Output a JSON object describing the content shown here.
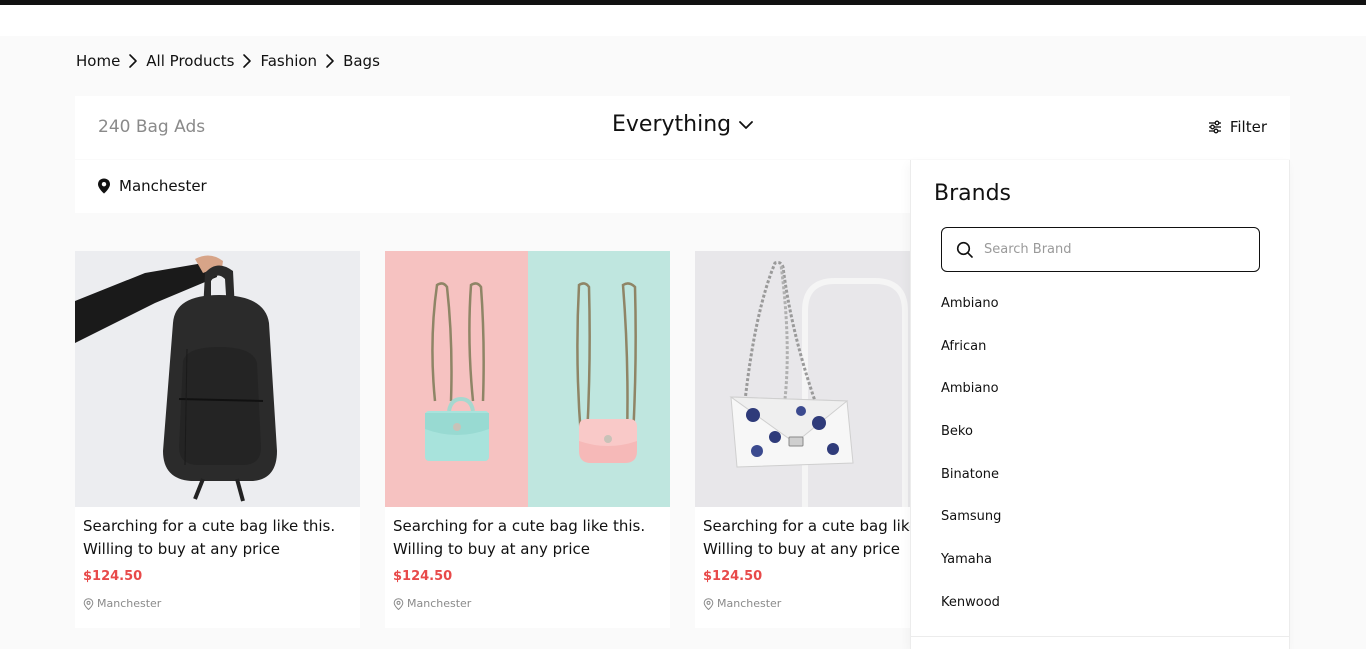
{
  "breadcrumb": [
    "Home",
    "All Products",
    "Fashion",
    "Bags"
  ],
  "toolbar": {
    "ad_count": "240 Bag Ads",
    "sort_label": "Everything",
    "filter_label": "Filter"
  },
  "location": "Manchester",
  "products": [
    {
      "title": "Searching for a cute bag like this. Willing to buy at any price",
      "price": "$124.50",
      "location": "Manchester",
      "image": "black-backpack"
    },
    {
      "title": "Searching for a cute bag like this. Willing to buy at any price",
      "price": "$124.50",
      "location": "Manchester",
      "image": "mini-bags-pink-mint"
    },
    {
      "title": "Searching for a cute bag like this. Willing to buy at any price",
      "price": "$124.50",
      "location": "Manchester",
      "image": "floral-chain-handbag"
    }
  ],
  "brands_panel": {
    "title": "Brands",
    "search_placeholder": "Search Brand",
    "items": [
      "Ambiano",
      "African",
      "Ambiano",
      "Beko",
      "Binatone",
      "Samsung",
      "Yamaha",
      "Kenwood"
    ]
  },
  "colors": {
    "price": "#e84a4a",
    "muted": "#8a8a8a",
    "background": "#fafafa"
  }
}
